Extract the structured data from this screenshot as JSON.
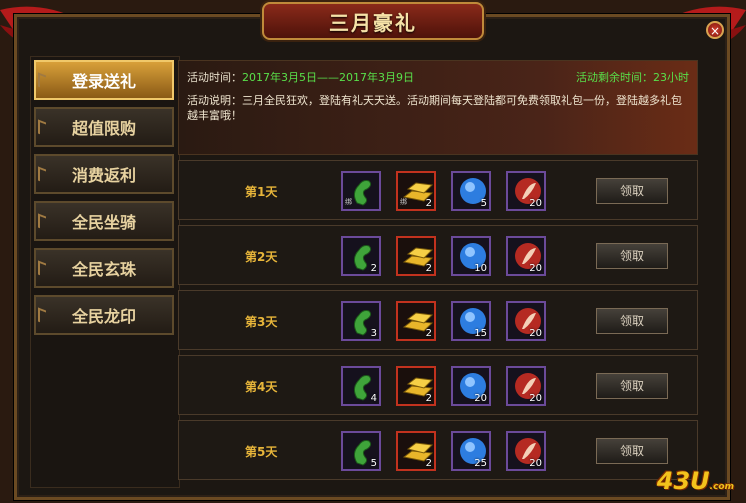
{
  "title": "三月豪礼",
  "close_symbol": "×",
  "sidebar": {
    "items": [
      {
        "label": "登录送礼",
        "active": true
      },
      {
        "label": "超值限购",
        "active": false
      },
      {
        "label": "消费返利",
        "active": false
      },
      {
        "label": "全民坐骑",
        "active": false
      },
      {
        "label": "全民玄珠",
        "active": false
      },
      {
        "label": "全民龙印",
        "active": false
      }
    ]
  },
  "info": {
    "time_label": "活动时间：",
    "time_value": "2017年3月5日——2017年3月9日",
    "remaining": "活动剩余时间：23小时",
    "description": "活动说明：三月全民狂欢，登陆有礼天天送。活动期间每天登陆都可免费领取礼包一份，登陆越多礼包越丰富哦！"
  },
  "rows": [
    {
      "day": "第1天",
      "counts": [
        "",
        "2",
        "5",
        "20"
      ],
      "button": "领取"
    },
    {
      "day": "第2天",
      "counts": [
        "2",
        "2",
        "10",
        "20"
      ],
      "button": "领取"
    },
    {
      "day": "第3天",
      "counts": [
        "3",
        "2",
        "15",
        "20"
      ],
      "button": "领取"
    },
    {
      "day": "第4天",
      "counts": [
        "4",
        "2",
        "20",
        "20"
      ],
      "button": "领取"
    },
    {
      "day": "第5天",
      "counts": [
        "5",
        "2",
        "25",
        "20"
      ],
      "button": "领取"
    }
  ],
  "item_icons": [
    "jade-dragon-icon",
    "gold-bars-icon",
    "blue-orb-icon",
    "red-feather-orb-icon"
  ],
  "bind_mark": "绑",
  "watermark": {
    "main": "43U",
    "sub": ".com"
  },
  "colors": {
    "accent_gold": "#e7b53a",
    "time_green": "#59e04a",
    "title_red": "#8a2a1a"
  }
}
